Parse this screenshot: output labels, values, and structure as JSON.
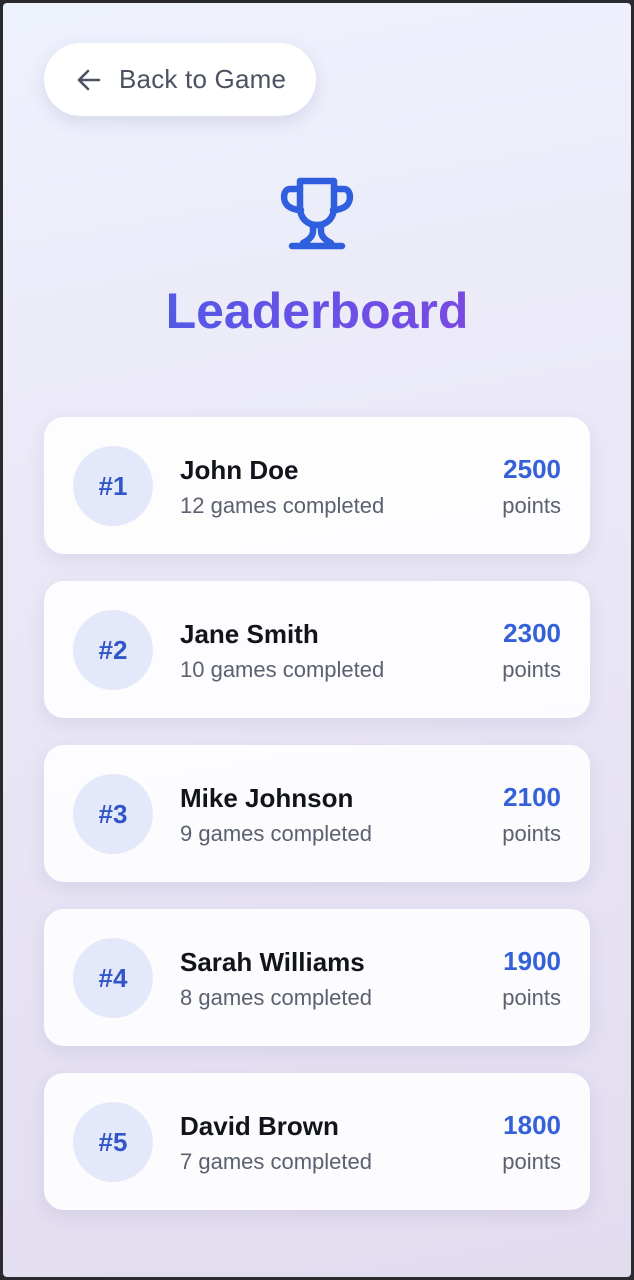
{
  "back_button": {
    "label": "Back to Game",
    "icon": "arrow-left-icon"
  },
  "header": {
    "icon": "trophy-icon",
    "title": "Leaderboard"
  },
  "colors": {
    "accent": "#3461d8",
    "title_gradient_start": "#3e63e6",
    "title_gradient_end": "#8a44df",
    "rank_badge_bg": "#e3e9fb"
  },
  "leaderboard": [
    {
      "rank": "#1",
      "name": "John Doe",
      "games": "12 games completed",
      "score": "2500",
      "unit": "points"
    },
    {
      "rank": "#2",
      "name": "Jane Smith",
      "games": "10 games completed",
      "score": "2300",
      "unit": "points"
    },
    {
      "rank": "#3",
      "name": "Mike Johnson",
      "games": "9 games completed",
      "score": "2100",
      "unit": "points"
    },
    {
      "rank": "#4",
      "name": "Sarah Williams",
      "games": "8 games completed",
      "score": "1900",
      "unit": "points"
    },
    {
      "rank": "#5",
      "name": "David Brown",
      "games": "7 games completed",
      "score": "1800",
      "unit": "points"
    }
  ]
}
